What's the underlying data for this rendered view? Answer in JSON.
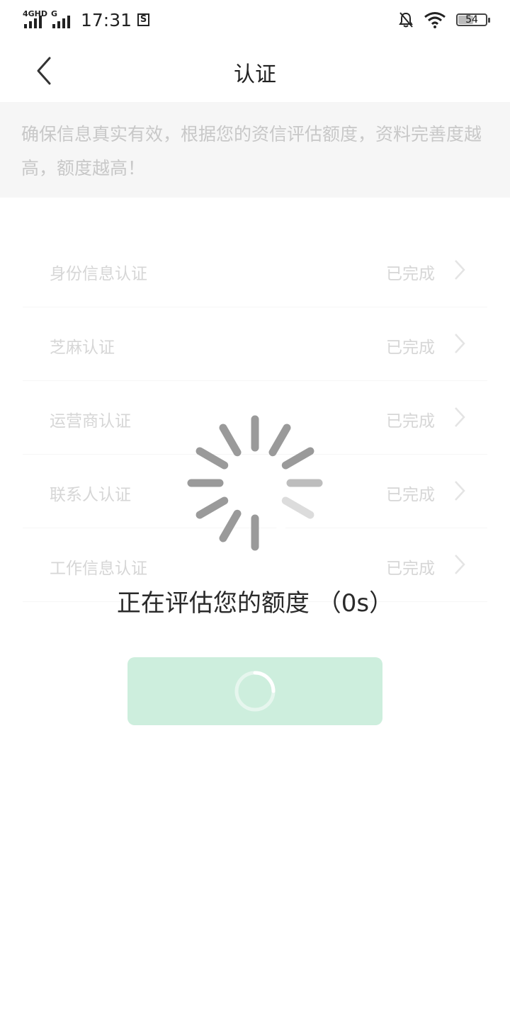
{
  "status_bar": {
    "network_1": "4GHD",
    "network_2": "G",
    "time": "17:31",
    "battery": "54",
    "battery_level": 0.54,
    "icons": [
      "signal-icon",
      "screenshot-icon",
      "mute-bell-icon",
      "wifi-icon",
      "battery-icon"
    ]
  },
  "nav": {
    "title": "认证",
    "back_icon": "chevron-left-icon"
  },
  "notice": {
    "text": "确保信息真实有效，根据您的资信评估额度，资料完善度越高，额度越高！"
  },
  "list": {
    "items": [
      {
        "label": "身份信息认证",
        "status": "已完成"
      },
      {
        "label": "芝麻认证",
        "status": "已完成"
      },
      {
        "label": "运营商认证",
        "status": "已完成"
      },
      {
        "label": "联系人认证",
        "status": "已完成"
      },
      {
        "label": "工作信息认证",
        "status": "已完成"
      }
    ]
  },
  "loading": {
    "text": "正在评估您的额度 （0s）"
  },
  "colors": {
    "button_bg": "#cdeedd",
    "notice_bg": "#f6f6f6",
    "muted_text": "#d6d6d6"
  }
}
